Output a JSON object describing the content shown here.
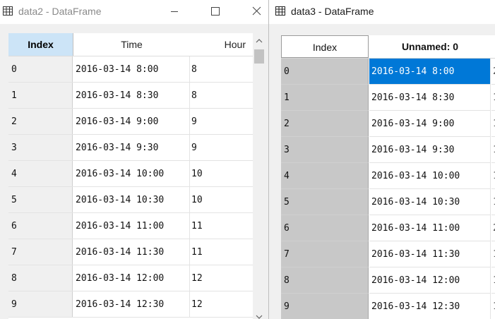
{
  "left_window": {
    "title": "data2 - DataFrame",
    "icon": "table-icon",
    "columns": [
      "Index",
      "Time",
      "Hour"
    ],
    "rows": [
      {
        "index": "0",
        "time": "2016-03-14 8:00",
        "hour": "8"
      },
      {
        "index": "1",
        "time": "2016-03-14 8:30",
        "hour": "8"
      },
      {
        "index": "2",
        "time": "2016-03-14 9:00",
        "hour": "9"
      },
      {
        "index": "3",
        "time": "2016-03-14 9:30",
        "hour": "9"
      },
      {
        "index": "4",
        "time": "2016-03-14 10:00",
        "hour": "10"
      },
      {
        "index": "5",
        "time": "2016-03-14 10:30",
        "hour": "10"
      },
      {
        "index": "6",
        "time": "2016-03-14 11:00",
        "hour": "11"
      },
      {
        "index": "7",
        "time": "2016-03-14 11:30",
        "hour": "11"
      },
      {
        "index": "8",
        "time": "2016-03-14 12:00",
        "hour": "12"
      },
      {
        "index": "9",
        "time": "2016-03-14 12:30",
        "hour": "12"
      }
    ]
  },
  "right_window": {
    "title": "data3 - DataFrame",
    "icon": "table-icon",
    "columns": [
      "Index",
      "Unnamed: 0"
    ],
    "selected_row": 0,
    "next_column_partial": [
      "2",
      "1",
      "1",
      "1",
      "1",
      "1",
      "2",
      "1",
      "1",
      "1"
    ],
    "rows": [
      {
        "index": "0",
        "value": "2016-03-14 8:00"
      },
      {
        "index": "1",
        "value": "2016-03-14 8:30"
      },
      {
        "index": "2",
        "value": "2016-03-14 9:00"
      },
      {
        "index": "3",
        "value": "2016-03-14 9:30"
      },
      {
        "index": "4",
        "value": "2016-03-14 10:00"
      },
      {
        "index": "5",
        "value": "2016-03-14 10:30"
      },
      {
        "index": "6",
        "value": "2016-03-14 11:00"
      },
      {
        "index": "7",
        "value": "2016-03-14 11:30"
      },
      {
        "index": "8",
        "value": "2016-03-14 12:00"
      },
      {
        "index": "9",
        "value": "2016-03-14 12:30"
      }
    ]
  },
  "colors": {
    "index_header_highlight": "#cce4f7",
    "selection": "#0078d7",
    "index_column_right": "#c8c8c8"
  }
}
